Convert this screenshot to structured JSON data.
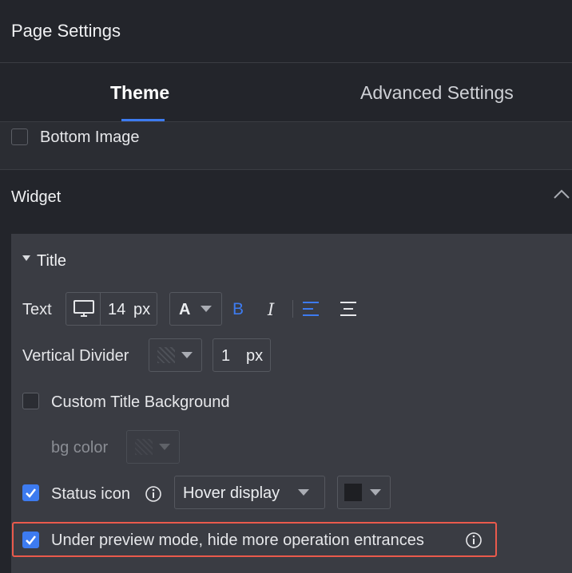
{
  "header": {
    "title": "Page Settings"
  },
  "tabs": {
    "theme": "Theme",
    "advanced": "Advanced Settings"
  },
  "bottom_image": {
    "label": "Bottom Image",
    "checked": false
  },
  "widget": {
    "label": "Widget"
  },
  "title_section": {
    "label": "Title",
    "text": {
      "label": "Text",
      "font_size": "14",
      "unit": "px",
      "font_glyph": "A",
      "bold_glyph": "B",
      "italic_glyph": "I"
    },
    "vertical_divider": {
      "label": "Vertical Divider",
      "value": "1",
      "unit": "px"
    },
    "custom_title_background": {
      "label": "Custom Title Background",
      "checked": false
    },
    "bg_color": {
      "label": "bg color"
    },
    "status_icon": {
      "label": "Status icon",
      "checked": true,
      "mode": "Hover display",
      "color": "#1e1f23"
    },
    "preview_mode": {
      "label": "Under preview mode, hide more operation entrances",
      "checked": true
    }
  },
  "colors": {
    "accent": "#3d7bf0",
    "highlight": "#ea5a4c"
  }
}
